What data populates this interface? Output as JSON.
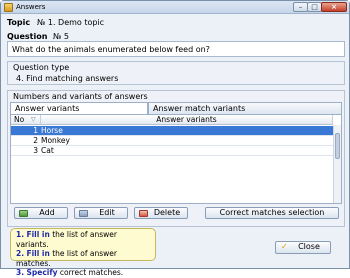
{
  "window": {
    "title": "Answers"
  },
  "topic": {
    "label": "Topic",
    "value": "№ 1. Demo topic"
  },
  "question": {
    "label": "Question",
    "value": "№ 5",
    "text": "What do the animals enumerated below feed on?"
  },
  "question_type": {
    "label": "Question type",
    "value": "4. Find matching answers"
  },
  "variants_section": {
    "label": "Numbers and variants of answers"
  },
  "tabs": [
    {
      "label": "Answer variants",
      "active": true
    },
    {
      "label": "Answer match variants",
      "active": false
    }
  ],
  "grid": {
    "columns": [
      "No",
      "Answer variants"
    ],
    "rows": [
      {
        "no": "1",
        "variant": "Horse",
        "selected": true
      },
      {
        "no": "2",
        "variant": "Monkey",
        "selected": false
      },
      {
        "no": "3",
        "variant": "Cat",
        "selected": false
      }
    ]
  },
  "buttons": {
    "add": "Add",
    "edit": "Edit",
    "delete": "Delete",
    "correct_matches": "Correct matches selection",
    "close": "Close"
  },
  "hints": [
    {
      "num": "1.",
      "key": "Fill in",
      "rest": " the list of answer variants."
    },
    {
      "num": "2.",
      "key": "Fill in",
      "rest": " the list of answer matches."
    },
    {
      "num": "3.",
      "key": "Specify",
      "rest": " correct matches."
    }
  ],
  "colors": {
    "selection": "#3a78d6",
    "hint_bg": "#fffbd0",
    "hint_keyword": "#1d2aa8"
  }
}
